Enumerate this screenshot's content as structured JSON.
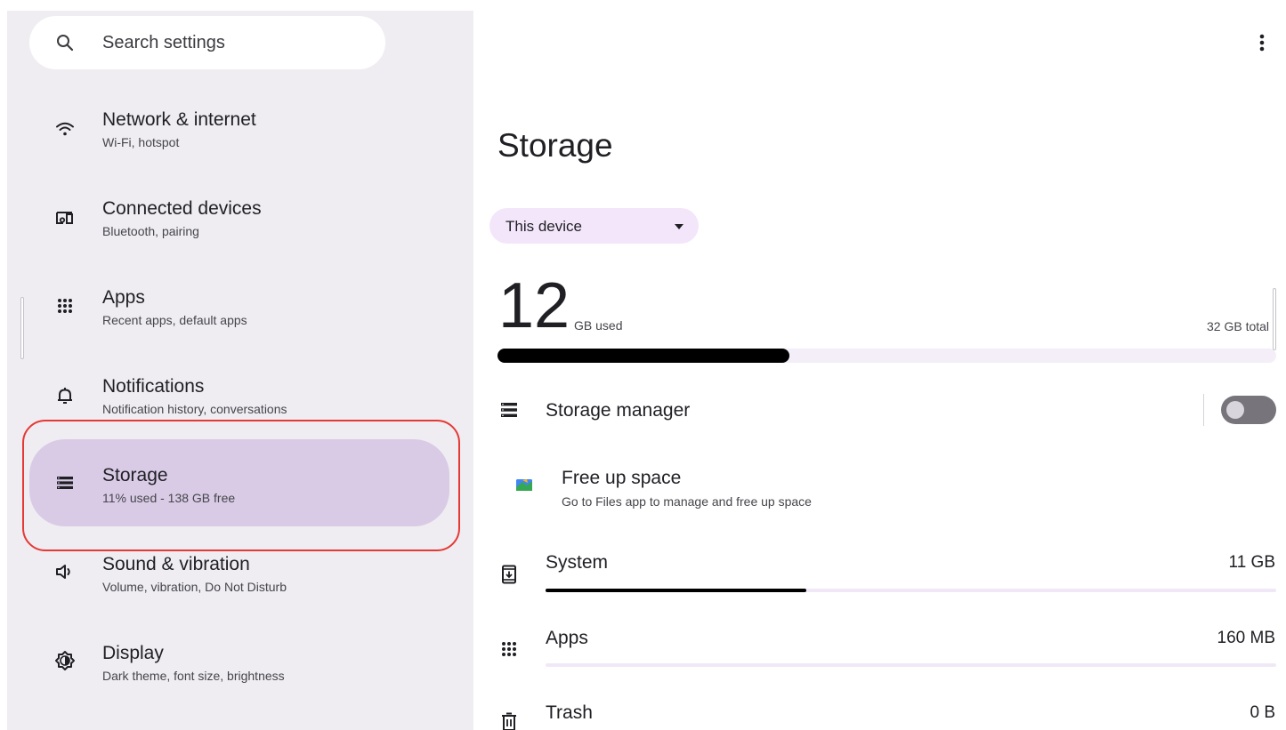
{
  "search": {
    "placeholder": "Search settings"
  },
  "nav": [
    {
      "title": "Network & internet",
      "subtitle": "Wi-Fi, hotspot",
      "icon": "wifi-icon"
    },
    {
      "title": "Connected devices",
      "subtitle": "Bluetooth, pairing",
      "icon": "devices-icon"
    },
    {
      "title": "Apps",
      "subtitle": "Recent apps, default apps",
      "icon": "apps-grid-icon"
    },
    {
      "title": "Notifications",
      "subtitle": "Notification history, conversations",
      "icon": "bell-icon"
    },
    {
      "title": "Storage",
      "subtitle": "11% used - 138 GB free",
      "icon": "storage-icon",
      "selected": true
    },
    {
      "title": "Sound & vibration",
      "subtitle": "Volume, vibration, Do Not Disturb",
      "icon": "volume-icon"
    },
    {
      "title": "Display",
      "subtitle": "Dark theme, font size, brightness",
      "icon": "brightness-icon"
    }
  ],
  "storage": {
    "page_title": "Storage",
    "device_selector": "This device",
    "used_number": "12",
    "used_label": "GB used",
    "total_label": "32 GB total",
    "used_fraction": 0.375,
    "storage_manager": {
      "label": "Storage manager",
      "enabled": false
    },
    "free_up": {
      "title": "Free up space",
      "subtitle": "Go to Files app to manage and free up space"
    },
    "categories": [
      {
        "name": "System",
        "value": "11 GB",
        "fraction": 0.357,
        "icon": "system-update-icon"
      },
      {
        "name": "Apps",
        "value": "160 MB",
        "fraction": 0.0,
        "icon": "apps-grid-icon"
      },
      {
        "name": "Trash",
        "value": "0 B",
        "fraction": 0.0,
        "icon": "trash-icon"
      }
    ]
  },
  "colors": {
    "left_pane_bg": "#efedf2",
    "selected_bg": "#d9cbe6",
    "dropdown_bg": "#f3e6fb",
    "highlight": "#e53935"
  }
}
